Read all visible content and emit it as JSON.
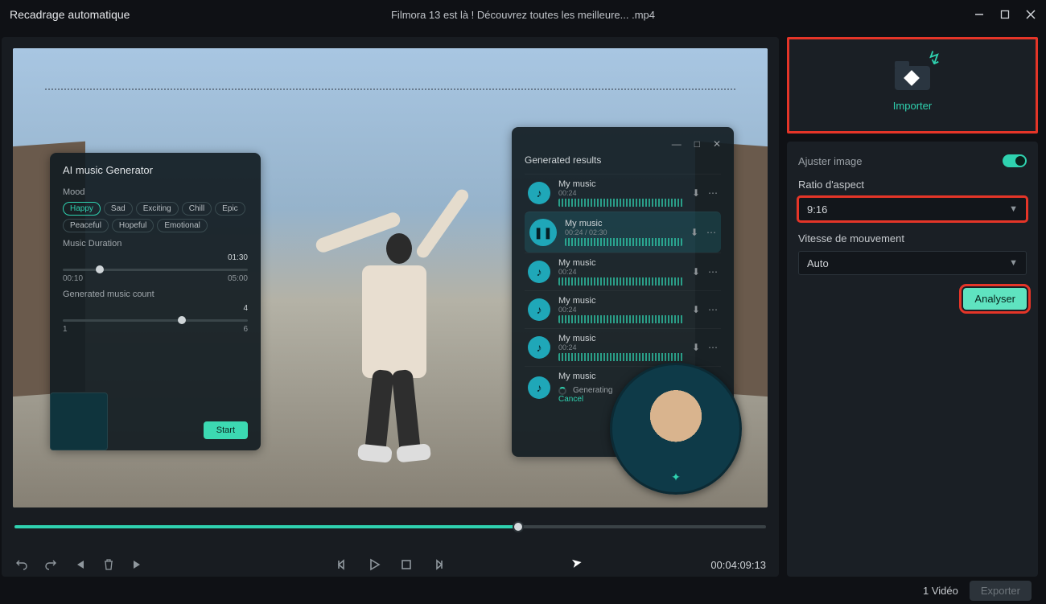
{
  "titlebar": {
    "app_title": "Recadrage automatique",
    "file_title": "Filmora 13 est là ! Découvrez toutes les meilleure... .mp4"
  },
  "overlay_left": {
    "title": "AI music Generator",
    "mood_label": "Mood",
    "moods": [
      "Happy",
      "Sad",
      "Exciting",
      "Chill",
      "Epic",
      "Peaceful",
      "Hopeful",
      "Emotional"
    ],
    "duration_label": "Music Duration",
    "duration_min": "00:10",
    "duration_max": "05:00",
    "duration_value": "01:30",
    "count_label": "Generated music count",
    "count_min": "1",
    "count_max": "6",
    "count_value": "4",
    "start": "Start"
  },
  "overlay_right": {
    "title": "Generated results",
    "tracks": [
      {
        "name": "My music",
        "time": "00:24"
      },
      {
        "name": "My music",
        "time": "00:24 / 02:30"
      },
      {
        "name": "My music",
        "time": "00:24"
      },
      {
        "name": "My music",
        "time": "00:24"
      },
      {
        "name": "My music",
        "time": "00:24"
      },
      {
        "name": "My music",
        "time": ""
      }
    ],
    "generating": "Generating",
    "cancel": "Cancel"
  },
  "player": {
    "progress_pct": 67,
    "timecode": "00:04:09:13"
  },
  "sidebar": {
    "import_label": "Importer",
    "adjust_label": "Ajuster image",
    "ratio_label": "Ratio d'aspect",
    "ratio_value": "9:16",
    "speed_label": "Vitesse de mouvement",
    "speed_value": "Auto",
    "analyse_label": "Analyser"
  },
  "footer": {
    "count": "1 Vidéo",
    "export": "Exporter"
  }
}
